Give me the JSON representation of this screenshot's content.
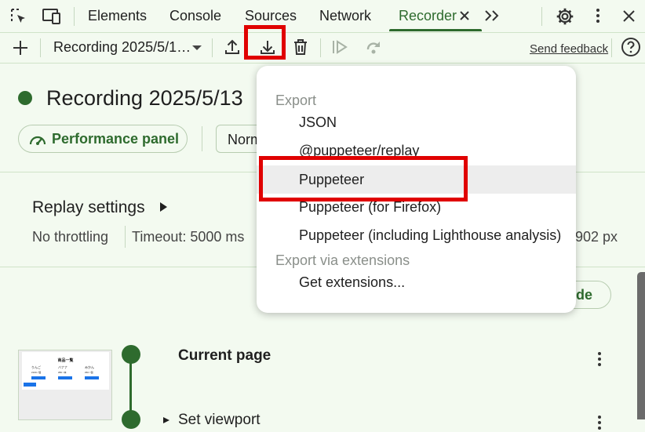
{
  "tabs": [
    {
      "label": "Elements"
    },
    {
      "label": "Console"
    },
    {
      "label": "Sources"
    },
    {
      "label": "Network"
    },
    {
      "label": "Recorder"
    }
  ],
  "toolbar": {
    "recording_select": "Recording 2025/5/1…",
    "send_feedback": "Send feedback"
  },
  "recording": {
    "title": "Recording 2025/5/13",
    "performance_panel": "Performance panel",
    "normal_partial": "Norm",
    "replay_settings": "Replay settings",
    "throttling": "No throttling",
    "timeout": "Timeout: 5000 ms",
    "viewport_partial": "902 px",
    "code_partial": "ode"
  },
  "steps": [
    {
      "title": "Current page"
    },
    {
      "title": "Set viewport"
    }
  ],
  "thumbnail": {
    "heading": "商品一覧",
    "items": [
      "りんご",
      "バナナ",
      "みかん"
    ],
    "prices": [
      "¥100 / 個",
      "¥80 / 本",
      "¥60 / 個"
    ]
  },
  "export_menu": {
    "header": "Export",
    "items": [
      "JSON",
      "@puppeteer/replay",
      "Puppeteer",
      "Puppeteer (for Firefox)",
      "Puppeteer (including Lighthouse analysis)"
    ],
    "ext_header": "Export via extensions",
    "ext_items": [
      "Get extensions..."
    ]
  },
  "colors": {
    "accent": "#2e6b2e",
    "background": "#f3faf0",
    "highlight_box": "#e00000"
  }
}
